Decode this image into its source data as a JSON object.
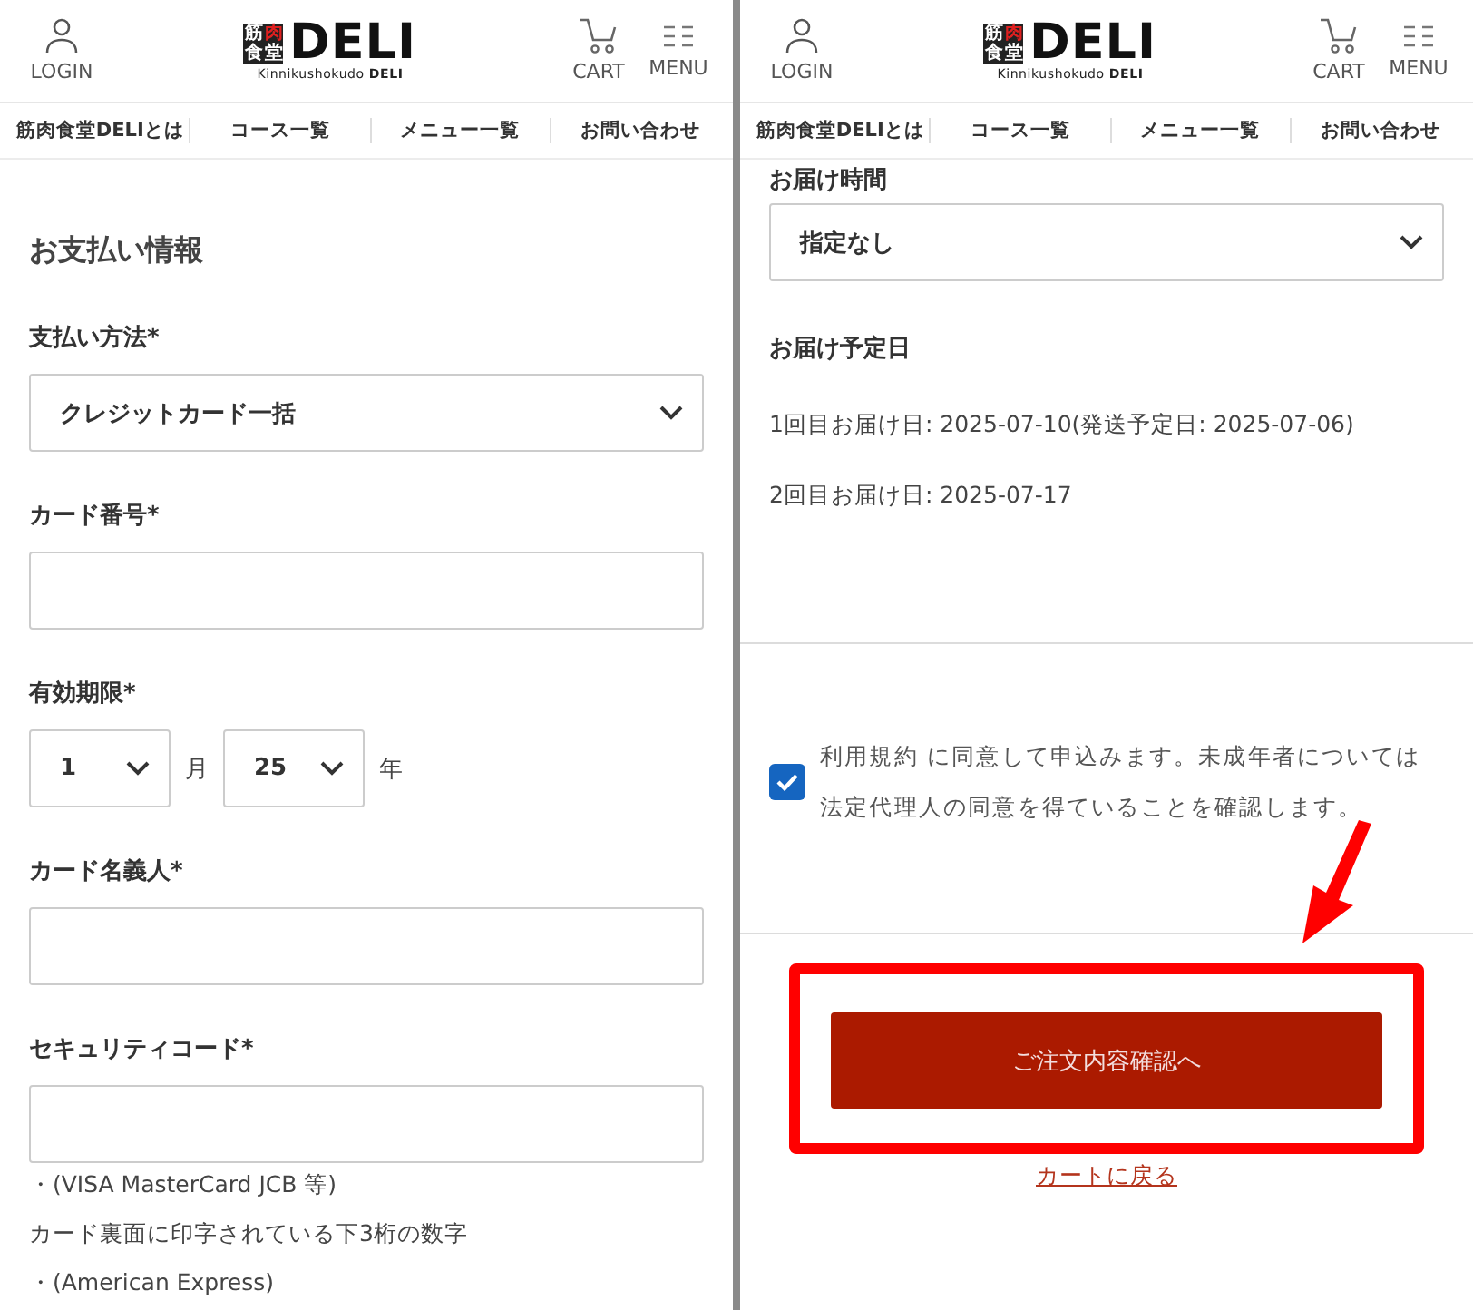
{
  "panels": [
    {
      "header": {
        "login": "LOGIN",
        "logo_mark": "筋肉食堂",
        "logo": "DELI",
        "logo_sub": "Kinnikushokudo **DELI**",
        "cart": "CART",
        "menu": "MENU"
      },
      "nav": [
        "筋肉食堂DELIとは",
        "コース一覧",
        "メニュー一覧",
        "お問い合わせ"
      ],
      "payment": {
        "title": "お支払い情報",
        "fields": [
          {
            "kind": "select",
            "label": "支払い方法*",
            "value": "クレジットカード一括"
          },
          {
            "kind": "input",
            "label": "カード番号*"
          },
          {
            "kind": "expiry",
            "label": "有効期限*",
            "month": "1",
            "month_unit": "月",
            "year": "25",
            "year_unit": "年"
          },
          {
            "kind": "input",
            "label": "カード名義人*"
          },
          {
            "kind": "input",
            "label": "セキュリティコード*"
          }
        ],
        "notes": [
          "・(VISA MasterCard JCB 等)",
          "カード裏面に印字されている下3桁の数字",
          "・(American Express)"
        ]
      }
    },
    {
      "header": {
        "login": "LOGIN",
        "logo_mark": "筋肉食堂",
        "logo": "DELI",
        "logo_sub": "Kinnikushokudo **DELI**",
        "cart": "CART",
        "menu": "MENU"
      },
      "nav": [
        "筋肉食堂DELIとは",
        "コース一覧",
        "メニュー一覧",
        "お問い合わせ"
      ],
      "delivery": {
        "time_label": "お届け時間",
        "time_value": "指定なし",
        "schedule_title": "お届け予定日",
        "schedule": [
          "1回目お届け日: 2025-07-10(発送予定日: 2025-07-06)",
          "2回目お届け日: 2025-07-17"
        ]
      },
      "agreement": {
        "checked": true,
        "text": "利用規約 に同意して申込みます。未成年者については法定代理人の同意を得ていることを確認します。"
      },
      "submit": "ご注文内容確認へ",
      "back_link": "カートに戻る"
    }
  ]
}
